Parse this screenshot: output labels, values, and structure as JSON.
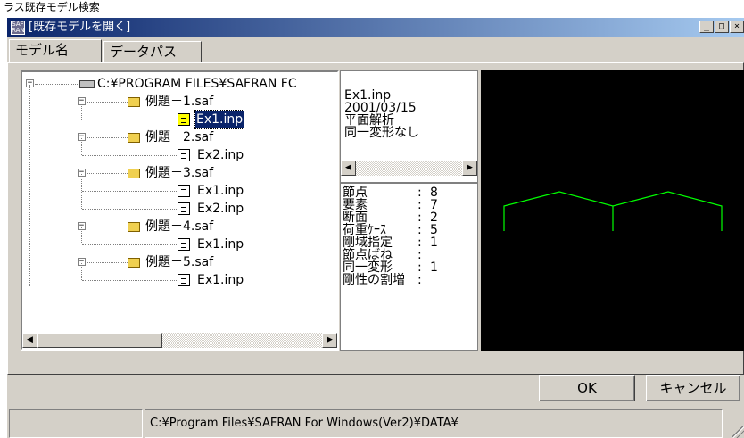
{
  "page": {
    "caption": "ラス既存モデル検索"
  },
  "window": {
    "title": "[既存モデルを開く]",
    "icon": "safran-app-icon",
    "controls": {
      "minimize": "_",
      "maximize": "□",
      "close": "×"
    }
  },
  "tabs": [
    {
      "label": "モデル名",
      "active": true
    },
    {
      "label": "データパス",
      "active": false
    }
  ],
  "tree": {
    "root": {
      "label": "C:¥PROGRAM FILES¥SAFRAN FC",
      "icon": "drive-icon"
    },
    "folders": [
      {
        "label": "例題－1.saf",
        "files": [
          {
            "label": "Ex1.inp",
            "selected": true
          }
        ]
      },
      {
        "label": "例題－2.saf",
        "files": [
          {
            "label": "Ex2.inp",
            "selected": false
          }
        ]
      },
      {
        "label": "例題－3.saf",
        "files": [
          {
            "label": "Ex1.inp",
            "selected": false
          },
          {
            "label": "Ex2.inp",
            "selected": false
          }
        ]
      },
      {
        "label": "例題－4.saf",
        "files": [
          {
            "label": "Ex1.inp",
            "selected": false
          }
        ]
      },
      {
        "label": "例題－5.saf",
        "files": [
          {
            "label": "Ex1.inp",
            "selected": false
          }
        ]
      }
    ]
  },
  "info": {
    "lines": [
      "Ex1.inp",
      "2001/03/15",
      "平面解析",
      "同一変形なし"
    ]
  },
  "stats": [
    {
      "key": "節点",
      "value": "8"
    },
    {
      "key": "要素",
      "value": "7"
    },
    {
      "key": "断面",
      "value": "2"
    },
    {
      "key": "荷重ｹｰｽ",
      "value": "5"
    },
    {
      "key": "剛域指定",
      "value": "1"
    },
    {
      "key": "節点ばね",
      "value": ""
    },
    {
      "key": "同一変形",
      "value": "1"
    },
    {
      "key": "剛性の割増",
      "value": ""
    }
  ],
  "preview": {
    "line_color": "#00ff00",
    "background": "#000000"
  },
  "buttons": {
    "ok": "OK",
    "cancel": "キャンセル"
  },
  "statusbar": {
    "path": "C:¥Program Files¥SAFRAN For Windows(Ver2)¥DATA¥"
  },
  "icons": {
    "scroll_left": "◀",
    "scroll_right": "▶",
    "expanded": "−"
  }
}
